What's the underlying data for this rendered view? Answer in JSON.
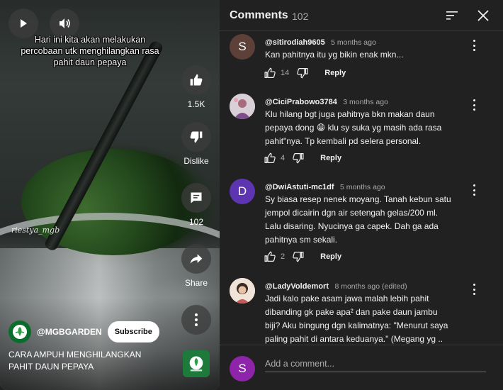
{
  "video": {
    "caption": "Hari ini kita akan melakukan percobaan utk menghilangkan rasa pahit daun pepaya",
    "watermark": "riestya_mgb",
    "play_icon": "play-icon",
    "volume_icon": "volume-icon",
    "like_count": "1.5K",
    "dislike_label": "Dislike",
    "comment_count": "102",
    "share_label": "Share",
    "channel_name": "@MGBGARDEN",
    "subscribe_label": "Subscribe",
    "title": "CARA AMPUH MENGHILANGKAN PAHIT DAUN PEPAYA"
  },
  "comments_panel": {
    "title": "Comments",
    "count": "102",
    "sort_icon": "sort-icon",
    "close_icon": "close-icon",
    "comments": [
      {
        "author": "@sitirodiah9605",
        "time": "5 months ago",
        "text": "Kan pahitnya itu yg bikin enak mkn...",
        "likes": "14",
        "reply_label": "Reply",
        "avatar_letter": "S",
        "avatar_color": "#5d4037"
      },
      {
        "author": "@CiciPrabowo3784",
        "time": "3 months ago",
        "text": "Klu hilang bgt juga pahitnya bkn makan daun pepaya dong 😁 klu sy suka yg masih ada rasa pahit\"nya. Tp kembali pd selera personal.",
        "likes": "4",
        "reply_label": "Reply",
        "avatar_color": "#c8b7c8"
      },
      {
        "author": "@DwiAstuti-mc1df",
        "time": "5 months ago",
        "text": "Sy biasa resep nenek moyang. Tanah kebun satu jempol dicairin dgn air setengah gelas/200 ml. Lalu disaring. Nyucinya ga capek. Dah ga ada pahitnya sm sekali.",
        "likes": "2",
        "reply_label": "Reply",
        "avatar_letter": "D",
        "avatar_color": "#5e35b1"
      },
      {
        "author": "@LadyVoldemort",
        "time": "8 months ago (edited)",
        "text": "Jadi kalo pake asam jawa malah lebih pahit dibanding gk pake apa² dan pake daun jambu biji? Aku bingung dgn kalimatnya: \"Menurut saya paling pahit di antara keduanya.\" (Megang yg ..",
        "avatar_color": "#e8d6c4"
      }
    ],
    "add_comment_placeholder": "Add a comment...",
    "user_avatar_letter": "S",
    "user_avatar_color": "#8e24aa"
  }
}
